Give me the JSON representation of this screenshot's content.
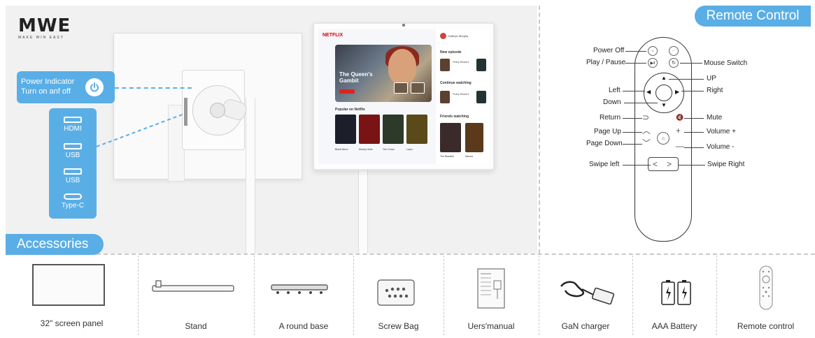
{
  "brand": {
    "logo": "MWE",
    "tagline": "MAKE WIN EASY"
  },
  "callouts": {
    "power_line1": "Power Indicator",
    "power_line2": "Turn on anf off",
    "power_icon": "power-icon",
    "ports": [
      {
        "label": "HDMI",
        "icon": "hdmi-port-icon"
      },
      {
        "label": "USB",
        "icon": "usb-port-icon"
      },
      {
        "label": "USB",
        "icon": "usb-port-icon"
      },
      {
        "label": "Type-C",
        "icon": "type-c-port-icon"
      }
    ]
  },
  "screen": {
    "app_logo": "NETFLIX",
    "hero_title": "The Queen's Gambit",
    "user_name": "Kathryn Murphy",
    "sections": {
      "new_episode": "New episode",
      "continue_watching": "Continue watching",
      "friends_watching": "Friends watching",
      "popular": "Popular on Netflix"
    },
    "popular_titles": [
      "Black Mirror",
      "Money Heist",
      "The Crown",
      "Lupin"
    ],
    "friends_titles": [
      "The Blacklist",
      "Narcos"
    ],
    "episode_titles": [
      "Peaky Blinders",
      "Peaky Blinders"
    ]
  },
  "remote": {
    "banner": "Remote Control",
    "left_labels": [
      "Power Off",
      "Play / Pause",
      "Left",
      "Down",
      "Return",
      "Page Up",
      "Page Down",
      "Swipe left"
    ],
    "right_labels": [
      "Mouse Switch",
      "UP",
      "Right",
      "Mute",
      "Volume +",
      "Volume -",
      "Swipe Right"
    ]
  },
  "accessories": {
    "banner": "Accessories",
    "items": [
      {
        "label": "32\" screen panel",
        "icon": "screen-panel-icon"
      },
      {
        "label": "Stand",
        "icon": "stand-icon"
      },
      {
        "label": "A round base",
        "icon": "round-base-icon"
      },
      {
        "label": "Screw Bag",
        "icon": "screw-bag-icon"
      },
      {
        "label": "Uers'manual",
        "icon": "manual-icon"
      },
      {
        "label": "GaN charger",
        "icon": "charger-icon"
      },
      {
        "label": "AAA Battery",
        "icon": "battery-icon"
      },
      {
        "label": "Remote control",
        "icon": "remote-icon"
      }
    ]
  },
  "colors": {
    "accent": "#5aaee6",
    "divider": "#c9c9c9"
  }
}
